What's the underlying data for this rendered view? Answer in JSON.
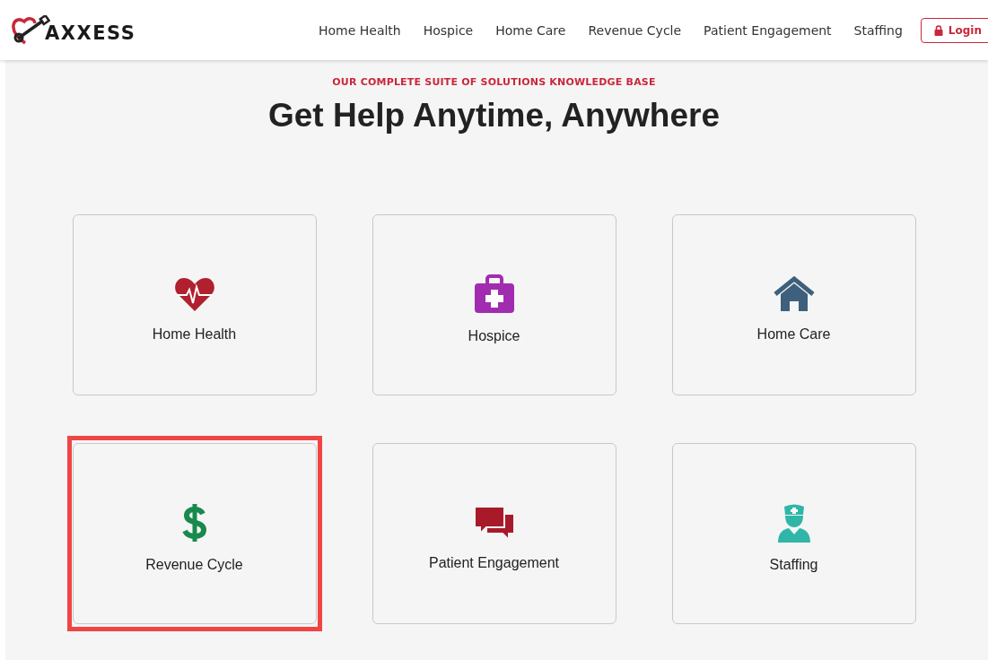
{
  "header": {
    "logo": "AXXESS",
    "nav": [
      "Home Health",
      "Hospice",
      "Home Care",
      "Revenue Cycle",
      "Patient Engagement",
      "Staffing"
    ],
    "login": "Login"
  },
  "hero": {
    "eyebrow": "OUR COMPLETE SUITE OF SOLUTIONS KNOWLEDGE BASE",
    "title": "Get Help Anytime, Anywhere"
  },
  "cards": [
    {
      "label": "Home Health",
      "kind": "heart",
      "highlighted": false
    },
    {
      "label": "Hospice",
      "kind": "medkit",
      "highlighted": false
    },
    {
      "label": "Home Care",
      "kind": "house",
      "highlighted": false
    },
    {
      "label": "Revenue Cycle",
      "kind": "dollar",
      "highlighted": true
    },
    {
      "label": "Patient Engagement",
      "kind": "chat",
      "highlighted": false
    },
    {
      "label": "Staffing",
      "kind": "nurse",
      "highlighted": false
    }
  ]
}
